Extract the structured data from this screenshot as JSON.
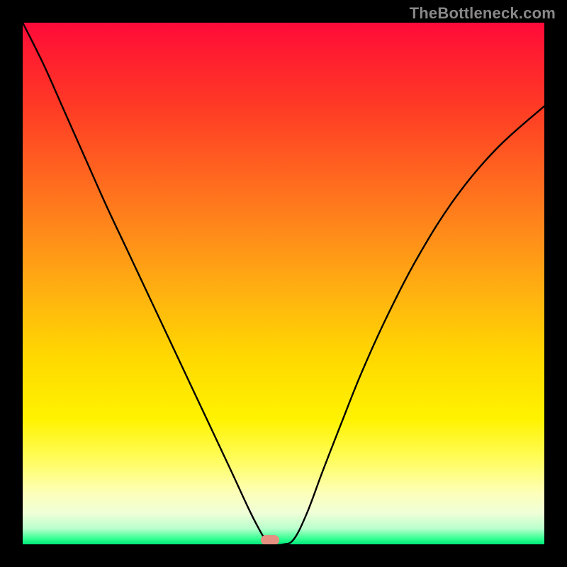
{
  "watermark": {
    "text": "TheBottleneck.com"
  },
  "marker": {
    "x_frac": 0.474,
    "y_frac": 0.992,
    "color": "#e59080"
  },
  "chart_data": {
    "type": "line",
    "title": "",
    "xlabel": "",
    "ylabel": "",
    "xlim": [
      0,
      1
    ],
    "ylim": [
      0,
      1
    ],
    "grid": false,
    "legend": false,
    "series": [
      {
        "name": "bottleneck-curve",
        "x": [
          0.0,
          0.04,
          0.08,
          0.12,
          0.16,
          0.2,
          0.24,
          0.28,
          0.32,
          0.36,
          0.4,
          0.43,
          0.45,
          0.465,
          0.48,
          0.5,
          0.52,
          0.545,
          0.575,
          0.61,
          0.65,
          0.7,
          0.76,
          0.83,
          0.91,
          1.0
        ],
        "y": [
          1.0,
          0.92,
          0.83,
          0.74,
          0.65,
          0.565,
          0.48,
          0.395,
          0.31,
          0.225,
          0.14,
          0.075,
          0.035,
          0.01,
          0.0,
          0.0,
          0.01,
          0.06,
          0.14,
          0.23,
          0.33,
          0.44,
          0.555,
          0.665,
          0.76,
          0.84
        ]
      }
    ],
    "annotations": []
  }
}
